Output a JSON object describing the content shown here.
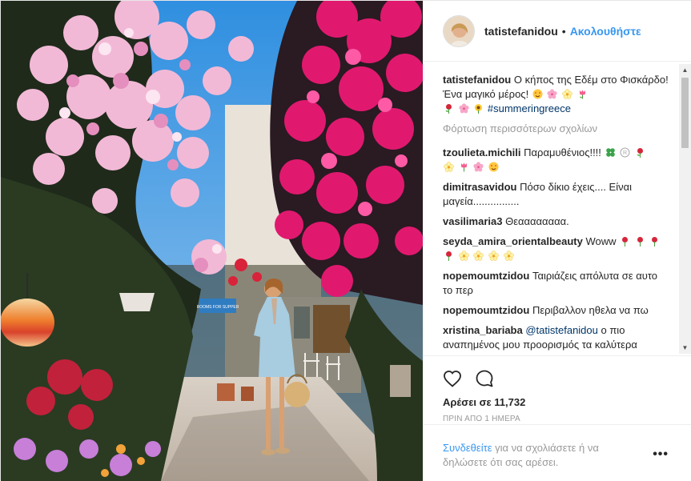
{
  "post": {
    "username": "tatistefanidou",
    "separator": "•",
    "follow_label": "Ακολουθήστε",
    "caption": {
      "user": "tatistefanidou",
      "text": "Ο κήπος της Εδέμ στο Φισκάρδο! Ένα μαγικό μέρος!",
      "hashtag": "#summeringreece"
    },
    "load_more": "Φόρτωση περισσότερων σχολίων",
    "comments": [
      {
        "user": "tzoulieta.michili",
        "text": "Παραμυθένιος!!!!"
      },
      {
        "user": "dimitrasavidou",
        "text": "Πόσο δίκιο έχεις.... Είναι μαγεία................"
      },
      {
        "user": "vasilimaria3",
        "text": "Θεαααααααα."
      },
      {
        "user": "seyda_amira_orientalbeauty",
        "text": "Woww"
      },
      {
        "user": "nopemoumtzidou",
        "text": "Ταιριάζεις απόλυτα σε αυτο το περ"
      },
      {
        "user": "nopemoumtzidou",
        "text": "Περιβαλλον ηθελα να πω"
      },
      {
        "user": "xristina_bariaba",
        "mention": "@tatistefanidou",
        "text": "ο πιο αναπημένος μου προορισμός τα καλύτερα"
      }
    ],
    "likes": "Αρέσει σε 11,732",
    "timestamp": "ΠΡΙΝ ΑΠΟ 1 ΗΜΕΡΑ",
    "login_link": "Συνδεθείτε",
    "login_rest": "για να σχολιάσετε ή να δηλώσετε ότι σας αρέσει.",
    "more_options": "•••"
  },
  "photo_sign_text": "ROOMS FOR SUPPER",
  "colors": {
    "link_blue": "#3897f0",
    "hashtag_blue": "#003569",
    "muted_gray": "#999999",
    "text": "#262626",
    "divider": "#efefef"
  },
  "icons": {
    "like": "heart-outline-icon",
    "comment": "speech-bubble-icon",
    "options": "ellipsis-icon"
  }
}
